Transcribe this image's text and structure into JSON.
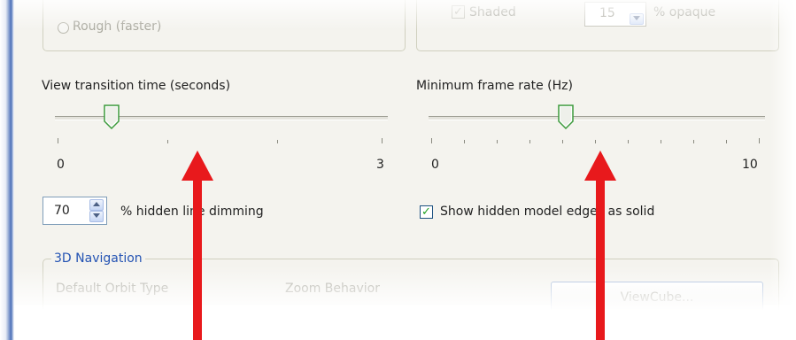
{
  "top_left_group": {
    "radio_rough_label": "Rough (faster)"
  },
  "top_right_group": {
    "shaded_label": "Shaded",
    "opacity_value": "15",
    "opacity_suffix": "% opaque"
  },
  "transition_slider": {
    "label": "View transition time (seconds)",
    "min_label": "0",
    "max_label": "3",
    "value_fraction": 0.17
  },
  "frame_rate_slider": {
    "label": "Minimum frame rate (Hz)",
    "min_label": "0",
    "max_label": "10",
    "value_fraction": 0.4
  },
  "hidden_line_dimming": {
    "value": "70",
    "label": "% hidden line dimming"
  },
  "hidden_edges_checkbox": {
    "checked": true,
    "label": "Show hidden model edges as solid"
  },
  "navigation_group": {
    "title": "3D Navigation",
    "orbit_type_label": "Default Orbit Type",
    "zoom_behavior_label": "Zoom Behavior",
    "viewcube_button": "ViewCube..."
  },
  "colors": {
    "arrow": "#e8191c",
    "slider_thumb_edge": "#3c9a3c",
    "panel_background": "#f4f3ee",
    "group_title": "#2453b3"
  }
}
